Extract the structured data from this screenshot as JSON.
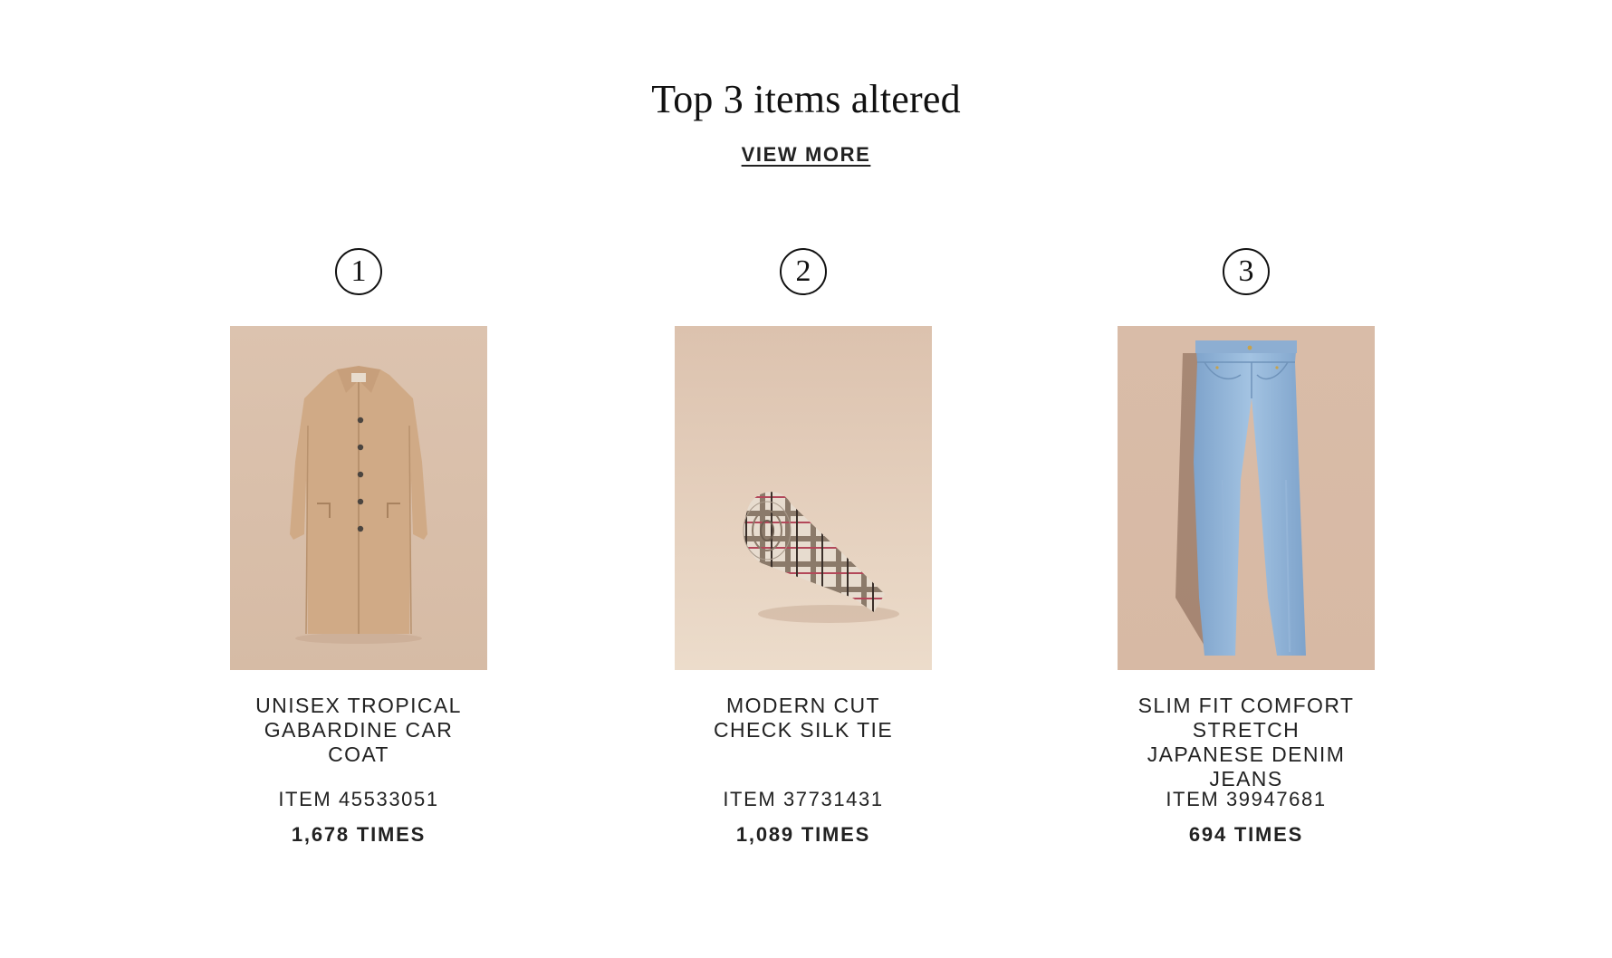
{
  "section": {
    "title": "Top 3 items altered",
    "view_more_label": "VIEW MORE"
  },
  "items": [
    {
      "rank": "1",
      "name": "UNISEX TROPICAL GABARDINE CAR COAT",
      "item_number": "ITEM 45533051",
      "times": "1,678 TIMES",
      "image": "beige-car-coat"
    },
    {
      "rank": "2",
      "name": "MODERN CUT CHECK SILK TIE",
      "item_number": "ITEM 37731431",
      "times": "1,089 TIMES",
      "image": "check-silk-tie"
    },
    {
      "rank": "3",
      "name": "SLIM FIT COMFORT STRETCH JAPANESE DENIM JEANS",
      "item_number": "ITEM 39947681",
      "times": "694 TIMES",
      "image": "light-blue-denim-jeans"
    }
  ],
  "colors": {
    "product_background": "#dbc2ae",
    "coat": "#d0aa86",
    "denim": "#8fb2d6"
  }
}
